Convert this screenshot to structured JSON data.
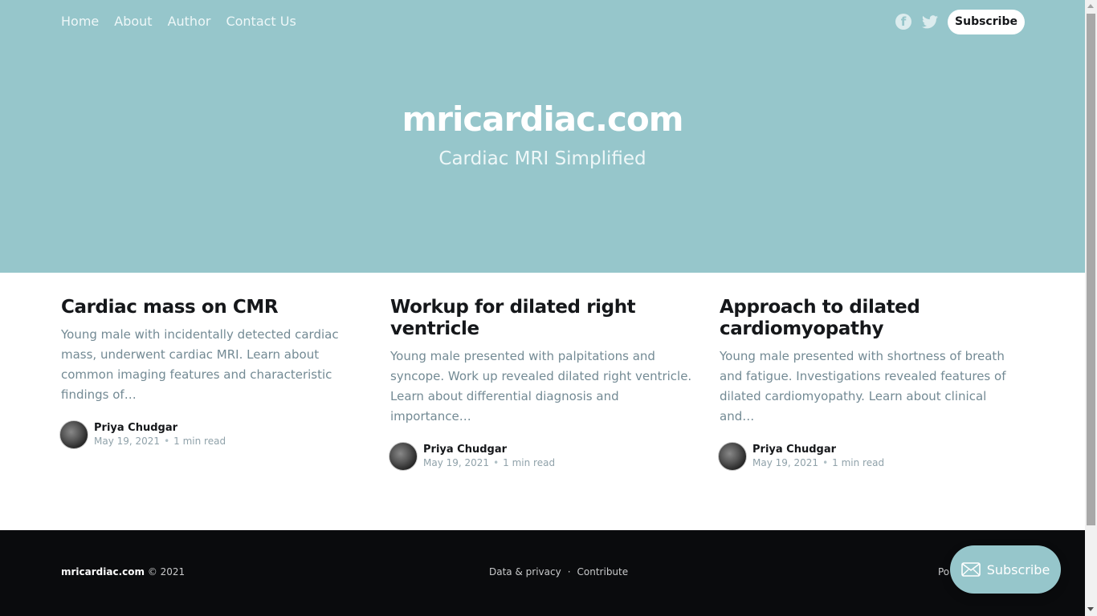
{
  "nav": {
    "items": [
      {
        "label": "Home"
      },
      {
        "label": "About"
      },
      {
        "label": "Author"
      },
      {
        "label": "Contact Us"
      }
    ]
  },
  "header": {
    "facebook_glyph": "f",
    "subscribe_label": "Subscribe"
  },
  "hero": {
    "title": "mricardiac.com",
    "description": "Cardiac MRI Simplified"
  },
  "posts": [
    {
      "title": "Cardiac mass on CMR",
      "excerpt": "Young male with incidentally detected cardiac mass, underwent cardiac MRI. Learn about common imaging features and characteristic findings of…",
      "author": "Priya Chudgar",
      "date": "May 19, 2021",
      "read_time": "1 min read"
    },
    {
      "title": "Workup for dilated right ventricle",
      "excerpt": "Young male presented with palpitations and syncope. Work up revealed dilated right ventricle. Learn about differential diagnosis and importance…",
      "author": "Priya Chudgar",
      "date": "May 19, 2021",
      "read_time": "1 min read"
    },
    {
      "title": "Approach to dilated cardiomyopathy",
      "excerpt": "Young male presented with shortness of breath and fatigue. Investigations revealed features of dilated cardiomyopathy. Learn about clinical and…",
      "author": "Priya Chudgar",
      "date": "May 19, 2021",
      "read_time": "1 min read"
    }
  ],
  "meta_separator": "•",
  "footer": {
    "site": "mricardiac.com",
    "copyright": "© 2021",
    "links": [
      {
        "label": "Data & privacy"
      },
      {
        "label": "Contribute"
      }
    ],
    "separator": "·",
    "powered_partial": "Po"
  },
  "portal": {
    "label": "Subscribe"
  }
}
